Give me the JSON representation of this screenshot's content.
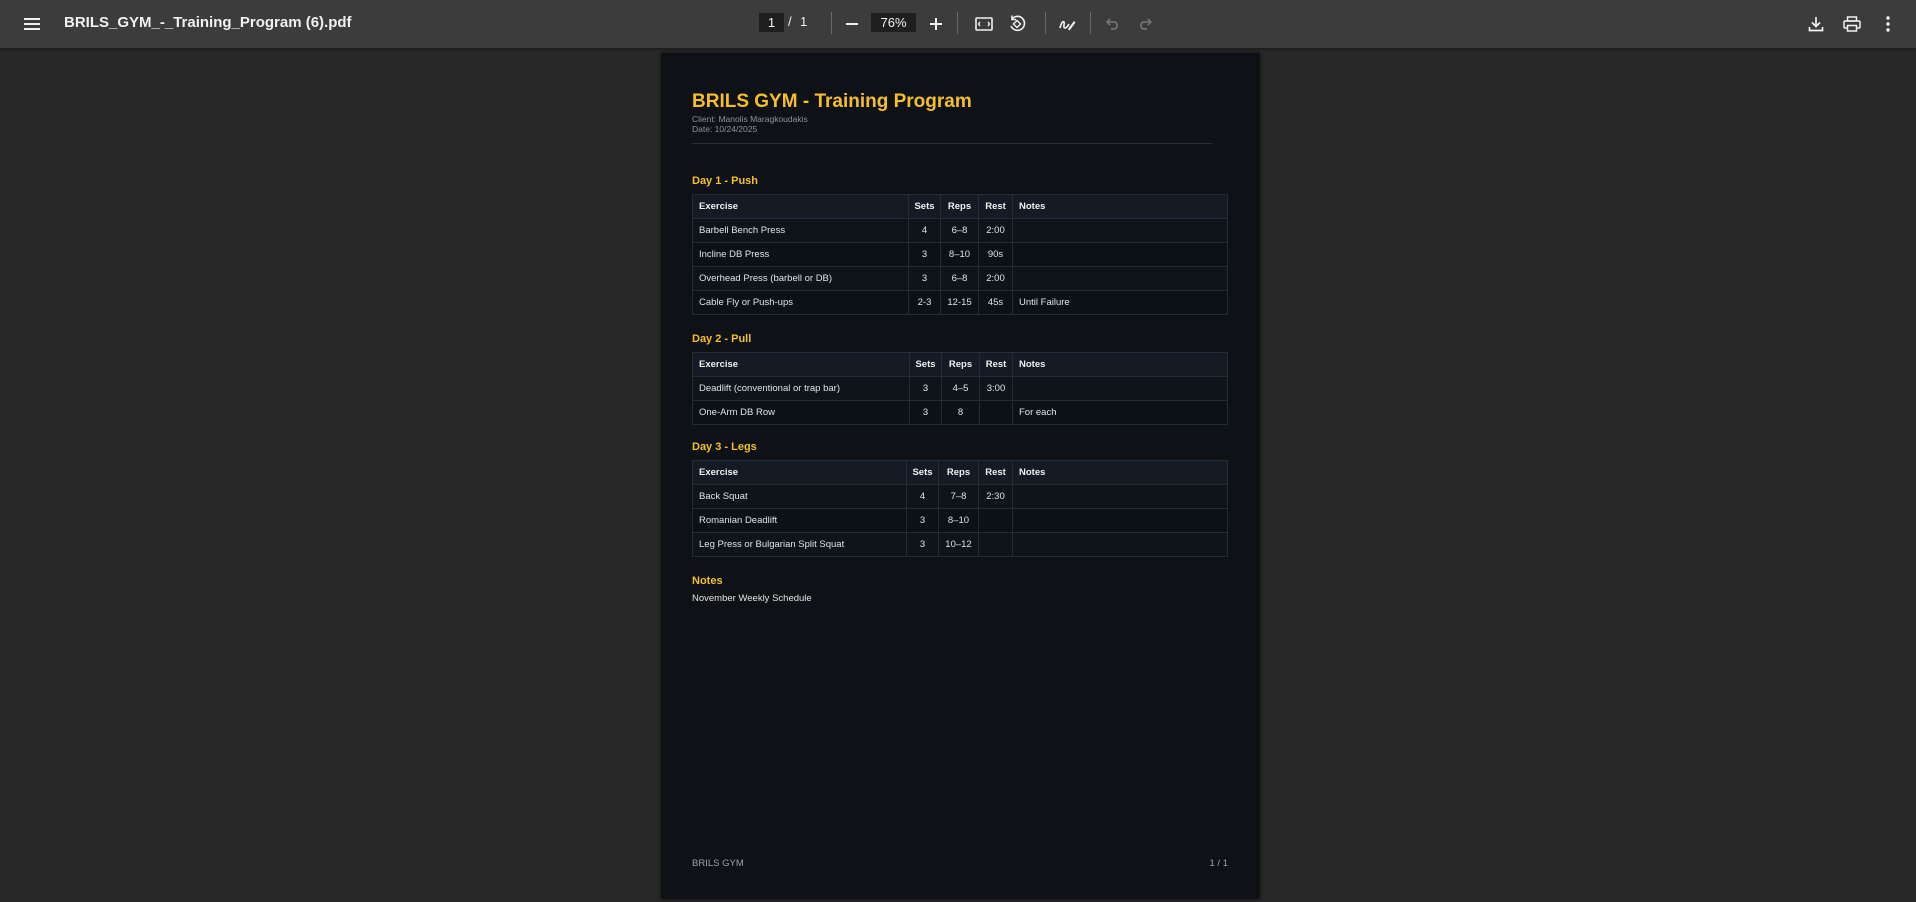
{
  "toolbar": {
    "file_name": "BRILS_GYM_-_Training_Program (6).pdf",
    "current_page": "1",
    "page_separator": "/",
    "total_pages": "1",
    "zoom": "76%",
    "icons": [
      "menu-icon",
      "zoom-out-icon",
      "zoom-in-icon",
      "fit-page-icon",
      "rotate-icon",
      "annotate-icon",
      "undo-icon",
      "redo-icon",
      "download-icon",
      "print-icon",
      "more-options-icon"
    ]
  },
  "document": {
    "title": "BRILS GYM - Training Program",
    "client": "Client: Manolis Maragkoudakis",
    "date": "Date: 10/24/2025",
    "column_headers": [
      "Exercise",
      "Sets",
      "Reps",
      "Rest",
      "Notes"
    ],
    "days": [
      {
        "title": "Day 1 - Push",
        "rows": [
          [
            "Barbell Bench Press",
            "4",
            "6–8",
            "2:00",
            ""
          ],
          [
            "Incline DB Press",
            "3",
            "8–10",
            "90s",
            ""
          ],
          [
            "Overhead Press (barbell or DB)",
            "3",
            "6–8",
            "2:00",
            ""
          ],
          [
            "Cable Fly or Push-ups",
            "2-3",
            "12-15",
            "45s",
            "Until Failure"
          ]
        ]
      },
      {
        "title": "Day 2 - Pull",
        "rows": [
          [
            "Deadlift (conventional or trap bar)",
            "3",
            "4–5",
            "3:00",
            ""
          ],
          [
            "One-Arm DB Row",
            "3",
            "8",
            "",
            "For each"
          ]
        ]
      },
      {
        "title": "Day 3 - Legs",
        "rows": [
          [
            "Back Squat",
            "4",
            "7–8",
            "2:30",
            ""
          ],
          [
            "Romanian Deadlift",
            "3",
            "8–10",
            "",
            ""
          ],
          [
            "Leg Press or Bulgarian Split Squat",
            "3",
            "10–12",
            "",
            ""
          ]
        ]
      }
    ],
    "notes_heading": "Notes",
    "notes_text": "November Weekly Schedule",
    "footer_left": "BRILS GYM",
    "footer_right": "1 / 1"
  },
  "colors": {
    "accent": "#f5bf2a",
    "toolbar_bg": "#3c3c3c",
    "viewer_bg": "#282828",
    "page_bg": "#0e1116"
  }
}
